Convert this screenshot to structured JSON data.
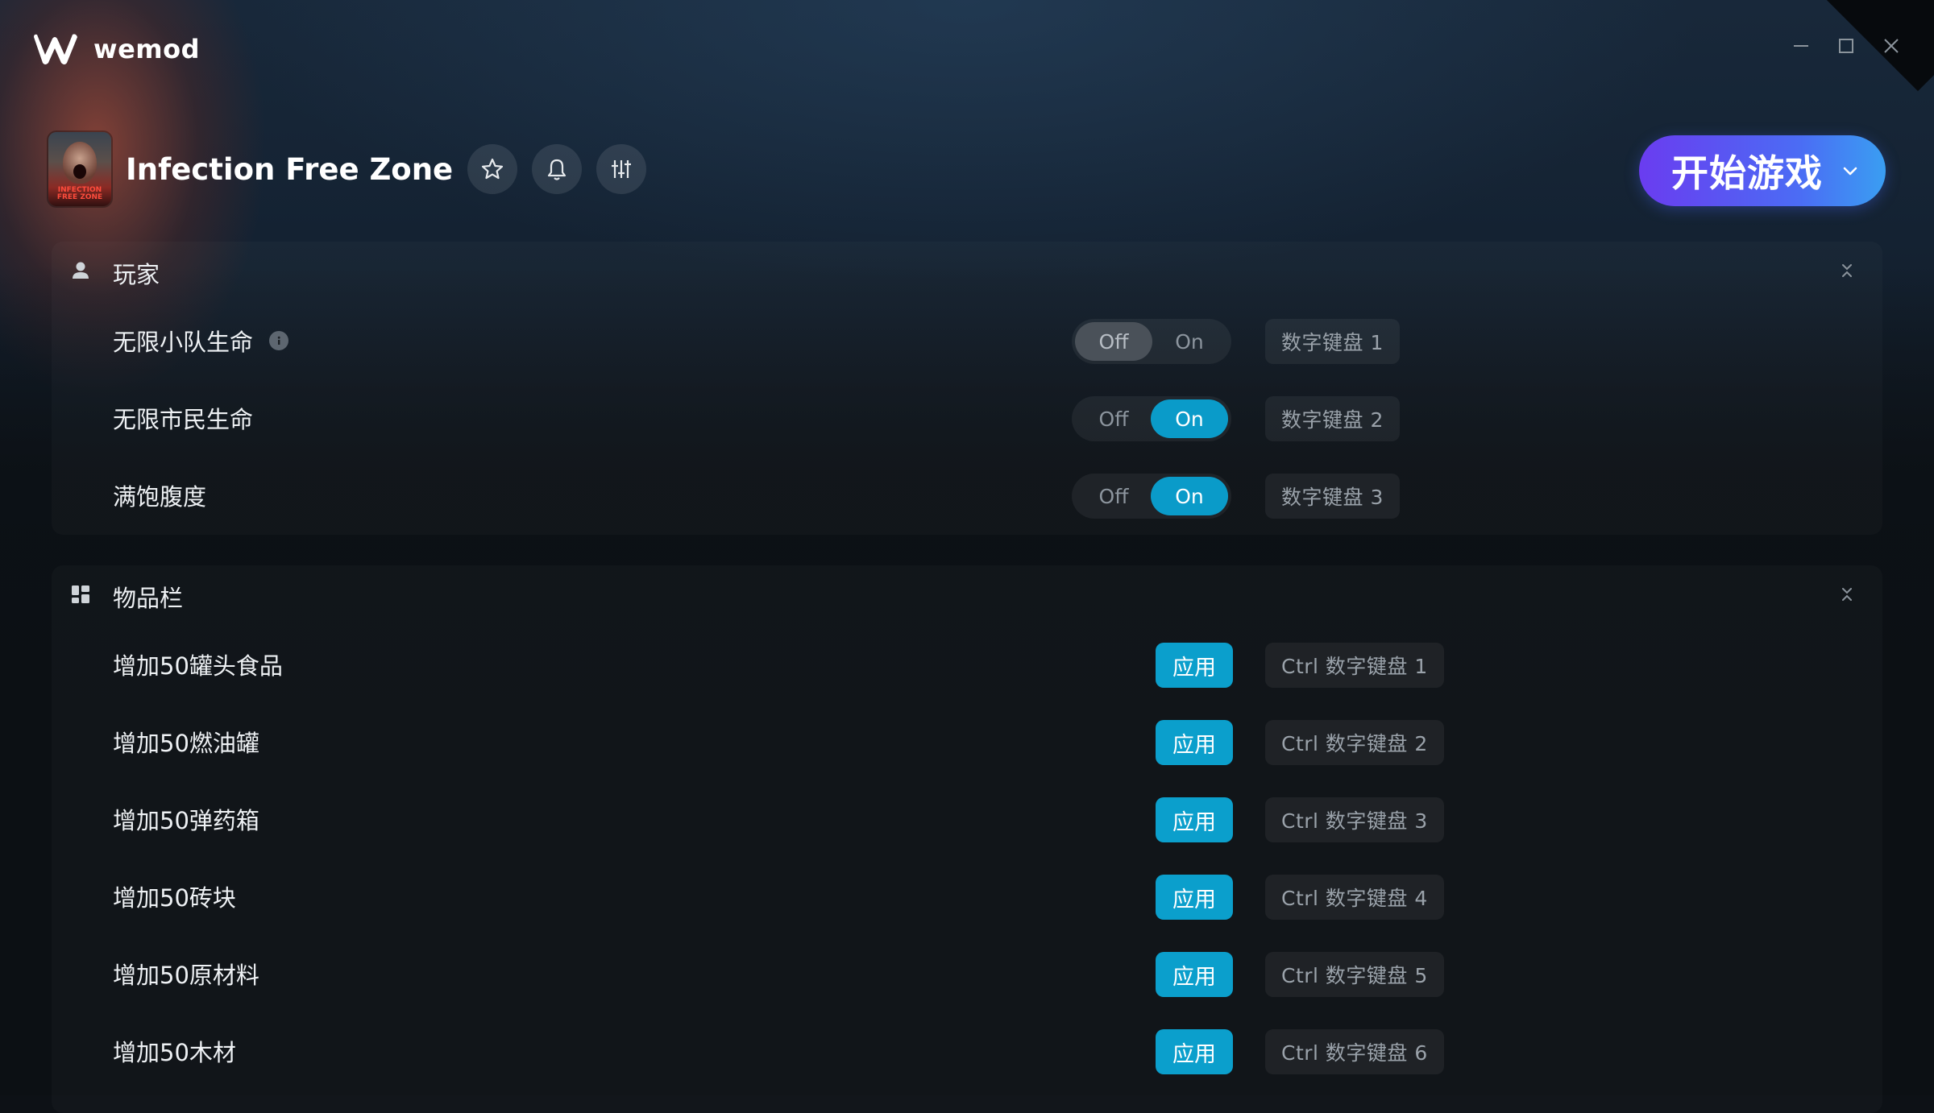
{
  "app": {
    "name": "wemod",
    "window_controls": [
      "minimize-icon",
      "maximize-icon",
      "close-icon"
    ]
  },
  "game": {
    "title": "Infection Free Zone",
    "cover_text": "INFECTION FREE ZONE",
    "actions": [
      "star-icon",
      "bell-icon",
      "sliders-icon"
    ],
    "play_label": "开始游戏"
  },
  "sections": {
    "players": {
      "title": "玩家",
      "icon": "user-icon",
      "rows": [
        {
          "label": "无限小队生命",
          "has_info": true,
          "off_label": "Off",
          "on_label": "On",
          "state": "off",
          "hotkey": "数字键盘 1"
        },
        {
          "label": "无限市民生命",
          "off_label": "Off",
          "on_label": "On",
          "state": "on",
          "hotkey": "数字键盘 2"
        },
        {
          "label": "满饱腹度",
          "off_label": "Off",
          "on_label": "On",
          "state": "on",
          "hotkey": "数字键盘 3"
        }
      ]
    },
    "inventory": {
      "title": "物品栏",
      "icon": "grid-icon",
      "rows": [
        {
          "label": "增加50罐头食品",
          "button": "应用",
          "hotkey": "Ctrl 数字键盘 1"
        },
        {
          "label": "增加50燃油罐",
          "button": "应用",
          "hotkey": "Ctrl 数字键盘 2"
        },
        {
          "label": "增加50弹药箱",
          "button": "应用",
          "hotkey": "Ctrl 数字键盘 3"
        },
        {
          "label": "增加50砖块",
          "button": "应用",
          "hotkey": "Ctrl 数字键盘 4"
        },
        {
          "label": "增加50原材料",
          "button": "应用",
          "hotkey": "Ctrl 数字键盘 5"
        },
        {
          "label": "增加50木材",
          "button": "应用",
          "hotkey": "Ctrl 数字键盘 6"
        }
      ]
    }
  },
  "colors": {
    "accent": "#0b9fcc",
    "play_gradient_start": "#6a3cf0",
    "play_gradient_end": "#3a9ef2",
    "background": "#0d1116"
  }
}
